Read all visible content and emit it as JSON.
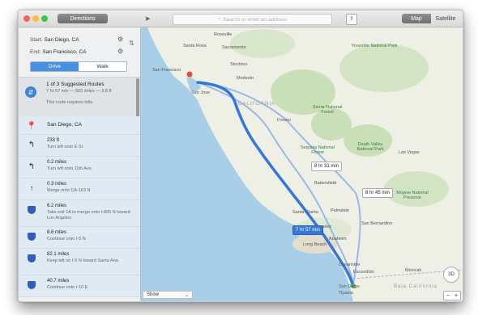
{
  "toolbar": {
    "directions_label": "Directions",
    "search_placeholder": "Search or enter an address",
    "map_label": "Map",
    "satellite_label": "Satellite"
  },
  "route": {
    "start_label": "Start:",
    "start_value": "San Diego, CA",
    "end_label": "End:",
    "end_value": "San Francisco, CA",
    "mode_drive": "Drive",
    "mode_walk": "Walk"
  },
  "suggestion": {
    "title": "1 of 3 Suggested Routes",
    "summary": "7 hr 57 min — 502 miles — 3.8 ft",
    "note": "This route requires tolls."
  },
  "steps": [
    {
      "distance": "San Diego, CA",
      "text": ""
    },
    {
      "distance": "233 ft",
      "text": "Turn left onto E St"
    },
    {
      "distance": "0.2 miles",
      "text": "Turn left onto 11th Ave"
    },
    {
      "distance": "0.3 miles",
      "text": "Merge onto CA-163 N"
    },
    {
      "distance": "6.2 miles",
      "text": "Take exit 1A to merge onto I-805 N toward Los Angeles"
    },
    {
      "distance": "8.8 miles",
      "text": "Continue onto I-5 N"
    },
    {
      "distance": "82.1 miles",
      "text": "Keep left on I-5 N toward Santa Ana"
    },
    {
      "distance": "40.7 miles",
      "text": "Continue onto I-10 E"
    }
  ],
  "map": {
    "labels": {
      "roseville": "Roseville",
      "santa_rosa": "Santa Rosa",
      "sacramento": "Sacramento",
      "san_francisco": "San Francisco",
      "stockton": "Stockton",
      "modesto": "Modesto",
      "san_jose": "San Jose",
      "california": "CALIFORNIA",
      "fresno": "Fresno",
      "yosemite": "Yosemite National Park",
      "sierra": "Sierra National Forest",
      "sequoia": "Sequoia National Forest",
      "death_valley": "Death Valley National Park",
      "las_vegas": "Las Vegas",
      "bakersfield": "Bakersfield",
      "palmdale": "Palmdale",
      "mojave": "Mojave National Preserve",
      "santa_clarita": "Santa Clarita",
      "los_angeles": "Los Angeles",
      "san_bernardino": "San Bernardino",
      "anaheim": "Anaheim",
      "long_beach": "Long Beach",
      "oceanside": "Oceanside",
      "escondido": "Escondido",
      "san_diego": "San Diego",
      "tijuana": "Tijuana",
      "mexicali": "Mexicali",
      "baja": "Baja California"
    },
    "eta_1": "8 hr 31 min",
    "eta_2": "8 hr 45 min",
    "eta_main": "7 hr 57 min",
    "show_label": "Show",
    "compass_label": "3D"
  },
  "colors": {
    "route_primary": "#3477d8",
    "route_alt": "#9bb9e6",
    "water": "#a9cfe8",
    "land": "#eef0e6",
    "park": "#c9dfb8"
  }
}
